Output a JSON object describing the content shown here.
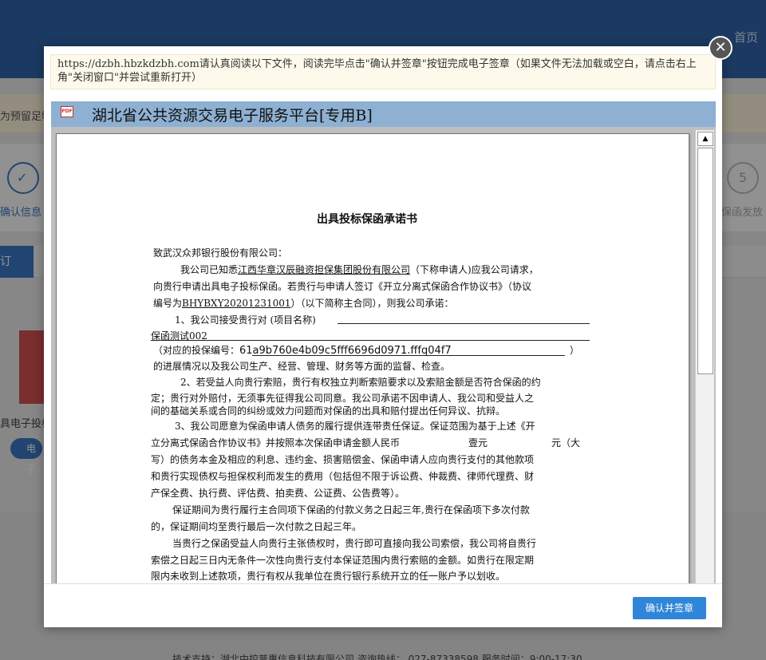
{
  "background": {
    "home_label": "首页",
    "notice_text": "为预留足够",
    "step1_label": "确认信息",
    "step5_number": "5",
    "step5_label": "保函发放",
    "tab_label": "订",
    "doc_label": "具电子投标",
    "pill_label": "电子",
    "footer_text": "技术支持：湖北中控普惠信息科技有限公司    咨询热线： 027-87338598 服务时间：9:00-17:30"
  },
  "modal": {
    "close_symbol": "✕",
    "instruction": "https://dzbh.hbzkdzbh.com请认真阅读以下文件，阅读完毕点击\"确认并签章\"按钮完成电子签章（如果文件无法加载或空白，请点击右上角\"关闭窗口\"并尝试重新打开）",
    "viewer_title": "湖北省公共资源交易电子服务平台[专用B]",
    "pdf_icon_label": "PDF",
    "confirm_button": "确认并签章",
    "scroll_up_symbol": "▲"
  },
  "document": {
    "title": "出具投标保函承诺书",
    "salutation": "致武汉众邦银行股份有限公司：",
    "p1_line1_prefix": "我公司已知悉",
    "p1_company": "江西华章汉辰融资担保集团股份有限公司",
    "p1_line1_suffix": "（下称申请人)应我公司请求，",
    "p1_line2": "向贵行申请出具电子投标保函。若贵行与申请人签订《开立分离式保函合作协议书》（协议",
    "p1_line3_prefix": "编号为",
    "p1_agreement_no": "BHYBXY20201231001",
    "p1_line3_suffix": "）（以下简称主合同），则我公司承诺：",
    "item1_label": "1、我公司接受贵行对 (项目名称)",
    "project_name": "保函测试002",
    "item1_code_prefix": "（对应的投保编号：",
    "policy_code": "61a9b760e4b09c5fff6696d0971.fffq04f7",
    "item1_code_suffix": "）",
    "item1_line3": "的进展情况以及我公司生产、经营、管理、财务等方面的监督、检查。",
    "item2_line1": "2、若受益人向贵行索赔，贵行有权独立判断索赔要求以及索赔金额是否符合保函的约",
    "item2_line2": "定；贵行对外赔付，无须事先征得我公司同意。我公司承诺不因申请人、我公司和受益人之",
    "item2_line3": "间的基础关系或合同的纠纷或效力问题而对保函的出具和赔付提出任何异议、抗辩。",
    "item3_line1": "3、我公司愿意为保函申请人债务的履行提供连带责任保证。保证范围为基于上述《开",
    "item3_line2_prefix": "立分离式保函合作协议书》并按照本次保函申请金额人民币",
    "amount_cn": "壹元",
    "item3_line2_suffix": "元（大",
    "item3_line3": "写）的债务本金及相应的利息、违约金、损害赔偿金、保函申请人应向贵行支付的其他款项",
    "item3_line4": "和贵行实现债权与担保权利而发生的费用（包括但不限于诉讼费、仲裁费、律师代理费、财",
    "item3_line5": "产保全费、执行费、评估费、拍卖费、公证费、公告费等）。",
    "para_a_line1": "保证期间为贵行履行主合同项下保函的付款义务之日起三年,贵行在保函项下多次付款",
    "para_a_line2": "的，保证期间均至贵行最后一次付款之日起三年。",
    "para_b_line1": "当贵行之保函受益人向贵行主张债权时，贵行即可直接向我公司索偿，我公司将自贵行",
    "para_b_line2": "索偿之日起三日内无条件一次性向贵行支付本保证范围内贵行索赔的金额。如贵行在限定期",
    "para_b_line3": "限内未收到上述款项，贵行有权从我单位在贵行银行系统开立的任一账户予以划收。"
  }
}
